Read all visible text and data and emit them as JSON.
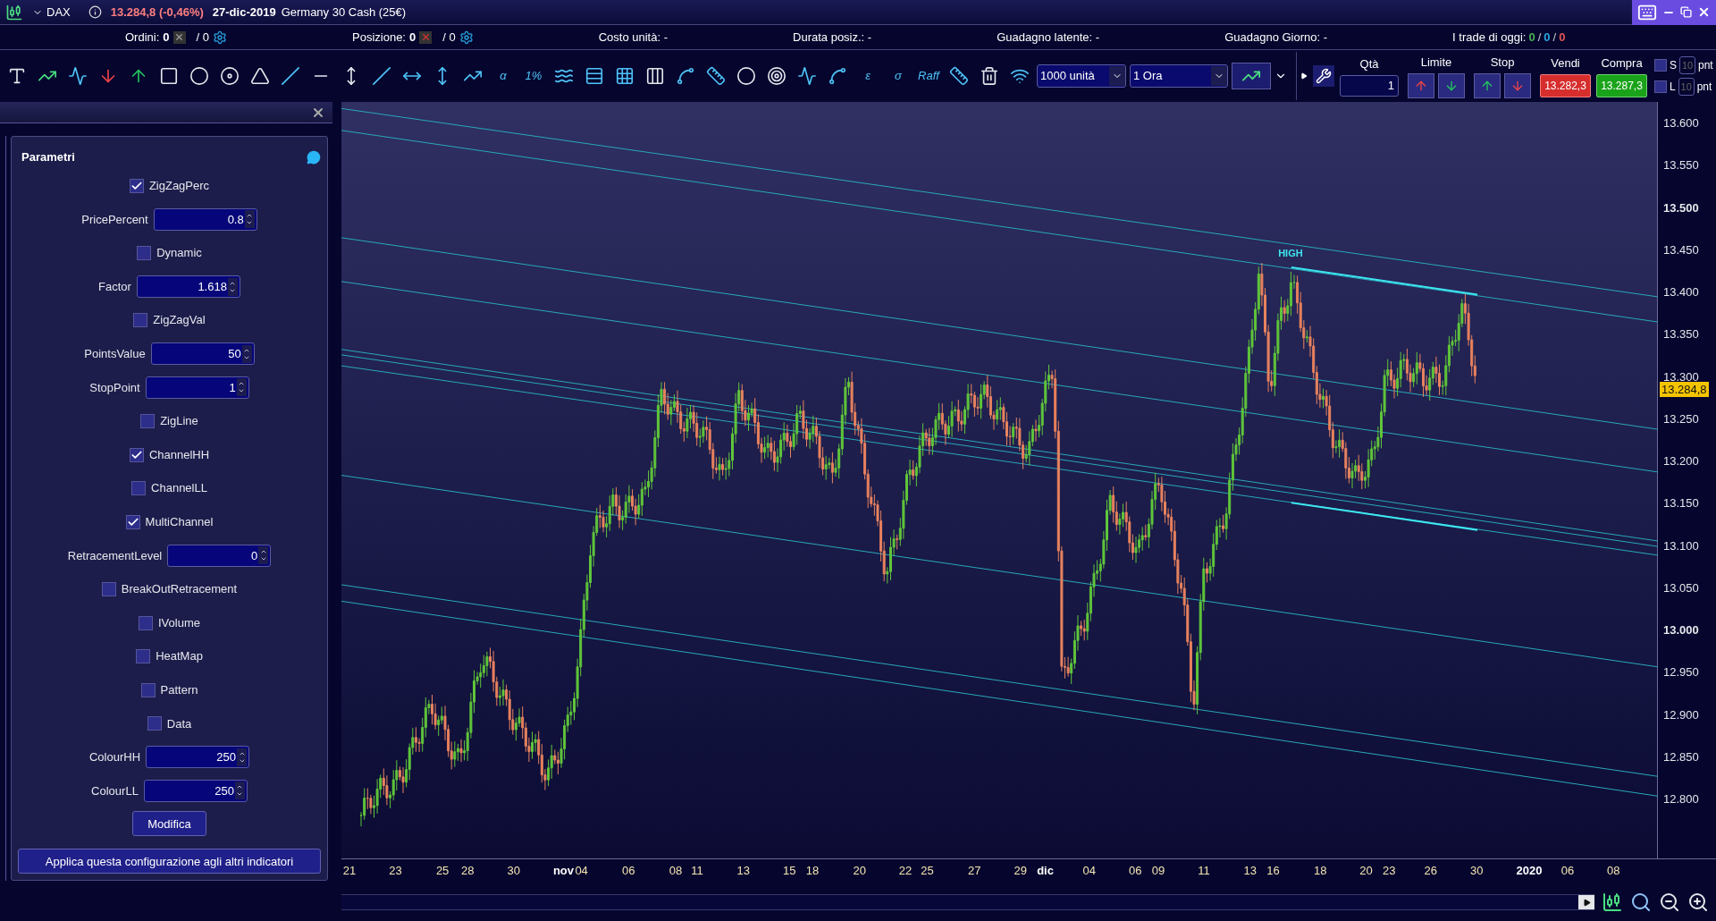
{
  "title_bar": {
    "symbol": "DAX",
    "price": "13.284,8 (-0,46%)",
    "date": "27-dic-2019",
    "instrument": "Germany 30 Cash (25€)"
  },
  "status_row": {
    "orders": {
      "label": "Ordini:",
      "value": "0",
      "total": "/ 0"
    },
    "position": {
      "label": "Posizione:",
      "value": "0",
      "total": "/ 0"
    },
    "fields": [
      {
        "label": "Costo unità:",
        "value": "-"
      },
      {
        "label": "Durata posiz.:",
        "value": "-"
      },
      {
        "label": "Guadagno latente:",
        "value": "-"
      },
      {
        "label": "Guadagno Giorno:",
        "value": "-"
      }
    ],
    "trades": {
      "label": "I trade di oggi:",
      "separators": [
        "/",
        "/"
      ],
      "counts": [
        {
          "value": "0",
          "color": "#4caf50"
        },
        {
          "value": "0",
          "color": "#29a3e0"
        },
        {
          "value": "0",
          "color": "#e05555"
        }
      ]
    }
  },
  "toolbar": {
    "text_tools": [
      "α",
      "1%",
      "ε",
      "σ",
      "Raff"
    ],
    "quantity_unit": "1000 unità",
    "timeframe": "1 Ora"
  },
  "order_panel": {
    "qty_label": "Qtà",
    "qty": "1",
    "limit_label": "Limite",
    "stop_label": "Stop",
    "sell_label": "Vendi",
    "sell_price": "13.282,3",
    "buy_label": "Compra",
    "buy_price": "13.287,3",
    "protections": [
      {
        "letter": "S",
        "placeholder": "10",
        "unit": "pnt",
        "checked": false
      },
      {
        "letter": "L",
        "placeholder": "10",
        "unit": "pnt",
        "checked": false
      }
    ]
  },
  "parameters": {
    "title": "Parametri",
    "items": [
      {
        "kind": "checkbox",
        "label": "ZigZagPerc",
        "checked": true
      },
      {
        "kind": "number",
        "label": "PricePercent",
        "value": "0.8"
      },
      {
        "kind": "checkbox",
        "label": "Dynamic",
        "checked": false
      },
      {
        "kind": "number",
        "label": "Factor",
        "value": "1.618"
      },
      {
        "kind": "checkbox",
        "label": "ZigZagVal",
        "checked": false
      },
      {
        "kind": "number",
        "label": "PointsValue",
        "value": "50"
      },
      {
        "kind": "number",
        "label": "StopPoint",
        "value": "1"
      },
      {
        "kind": "checkbox",
        "label": "ZigLine",
        "checked": false
      },
      {
        "kind": "checkbox",
        "label": "ChannelHH",
        "checked": true
      },
      {
        "kind": "checkbox",
        "label": "ChannelLL",
        "checked": false
      },
      {
        "kind": "checkbox",
        "label": "MultiChannel",
        "checked": true
      },
      {
        "kind": "number",
        "label": "RetracementLevel",
        "value": "0"
      },
      {
        "kind": "checkbox",
        "label": "BreakOutRetracement",
        "checked": false
      },
      {
        "kind": "checkbox",
        "label": "IVolume",
        "checked": false
      },
      {
        "kind": "checkbox",
        "label": "HeatMap",
        "checked": false
      },
      {
        "kind": "checkbox",
        "label": "Pattern",
        "checked": false
      },
      {
        "kind": "checkbox",
        "label": "Data",
        "checked": false
      },
      {
        "kind": "number",
        "label": "ColourHH",
        "value": "250"
      },
      {
        "kind": "number",
        "label": "ColourLL",
        "value": "250"
      }
    ],
    "modify_button": "Modifica",
    "apply_button": "Applica questa configurazione agli altri indicatori"
  },
  "chart": {
    "high_label": "HIGH",
    "last_price": "13.284,8",
    "price_ticks": [
      {
        "label": "13.600",
        "major": false
      },
      {
        "label": "13.550",
        "major": false
      },
      {
        "label": "13.500",
        "major": true
      },
      {
        "label": "13.450",
        "major": false
      },
      {
        "label": "13.400",
        "major": false
      },
      {
        "label": "13.350",
        "major": false
      },
      {
        "label": "13.300",
        "major": false
      },
      {
        "label": "13.250",
        "major": false
      },
      {
        "label": "13.200",
        "major": false
      },
      {
        "label": "13.150",
        "major": false
      },
      {
        "label": "13.100",
        "major": false
      },
      {
        "label": "13.050",
        "major": false
      },
      {
        "label": "13.000",
        "major": true
      },
      {
        "label": "12.950",
        "major": false
      },
      {
        "label": "12.900",
        "major": false
      },
      {
        "label": "12.850",
        "major": false
      },
      {
        "label": "12.800",
        "major": false
      }
    ],
    "date_ticks": [
      {
        "label": "21",
        "major": false
      },
      {
        "label": "23",
        "major": false
      },
      {
        "label": "25",
        "major": false
      },
      {
        "label": "28",
        "major": false
      },
      {
        "label": "30",
        "major": false
      },
      {
        "label": "nov",
        "major": true
      },
      {
        "label": "04",
        "major": false
      },
      {
        "label": "06",
        "major": false
      },
      {
        "label": "08",
        "major": false
      },
      {
        "label": "11",
        "major": false
      },
      {
        "label": "13",
        "major": false
      },
      {
        "label": "15",
        "major": false
      },
      {
        "label": "18",
        "major": false
      },
      {
        "label": "20",
        "major": false
      },
      {
        "label": "22",
        "major": false
      },
      {
        "label": "25",
        "major": false
      },
      {
        "label": "27",
        "major": false
      },
      {
        "label": "29",
        "major": false
      },
      {
        "label": "dic",
        "major": true
      },
      {
        "label": "04",
        "major": false
      },
      {
        "label": "06",
        "major": false
      },
      {
        "label": "09",
        "major": false
      },
      {
        "label": "11",
        "major": false
      },
      {
        "label": "13",
        "major": false
      },
      {
        "label": "16",
        "major": false
      },
      {
        "label": "18",
        "major": false
      },
      {
        "label": "20",
        "major": false
      },
      {
        "label": "23",
        "major": false
      },
      {
        "label": "26",
        "major": false
      },
      {
        "label": "30",
        "major": false
      },
      {
        "label": "2020",
        "major": true
      },
      {
        "label": "06",
        "major": false
      },
      {
        "label": "08",
        "major": false
      }
    ]
  }
}
